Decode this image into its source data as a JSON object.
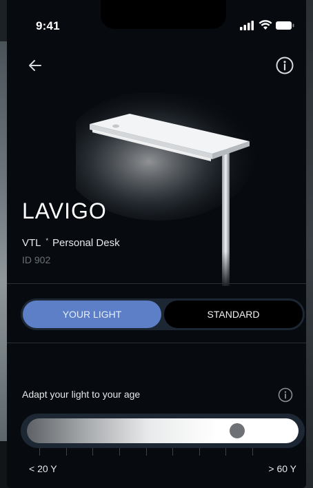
{
  "status_bar": {
    "time": "9:41",
    "icons": [
      "signal-icon",
      "wifi-icon",
      "battery-icon"
    ]
  },
  "header": {
    "back_icon": "arrow-left-icon",
    "info_icon": "info-icon"
  },
  "product": {
    "name": "LAVIGO",
    "brand": "VTL",
    "separator": "*",
    "category": "Personal Desk",
    "id": "ID 902"
  },
  "mode_toggle": {
    "options": [
      "YOUR LIGHT",
      "STANDARD"
    ],
    "selected": "YOUR LIGHT"
  },
  "age_adapt": {
    "label": "Adapt your light to your age",
    "min_label": "< 20 Y",
    "max_label": "> 60 Y",
    "value_fraction": 0.79,
    "tick_count": 9
  },
  "colors": {
    "background": "#070b10",
    "accent": "#5d7fc7",
    "toggle_track": "#1c2733"
  }
}
